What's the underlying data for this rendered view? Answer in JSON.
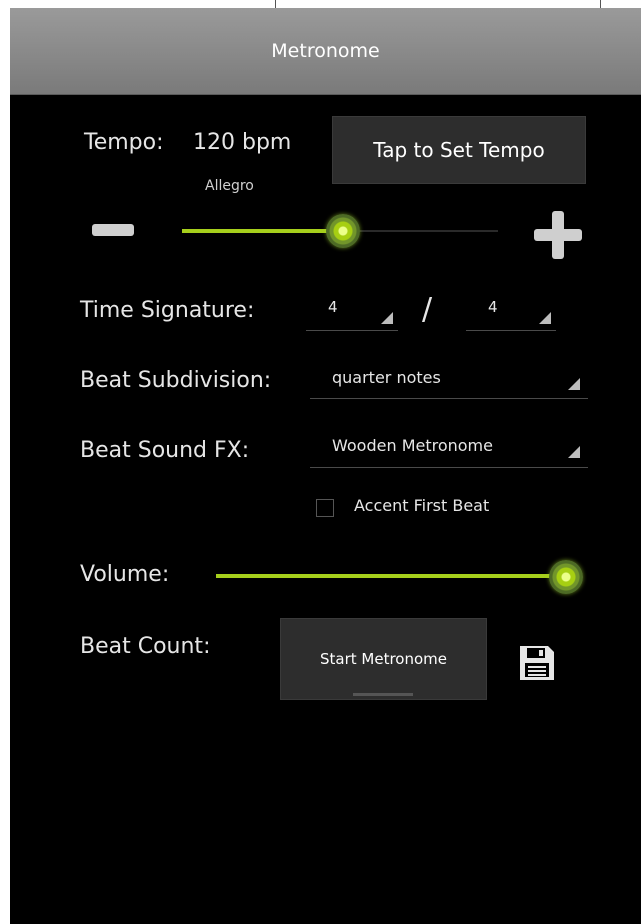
{
  "header": {
    "title": "Metronome"
  },
  "tempo": {
    "label": "Tempo:",
    "value": "120 bpm",
    "name": "Allegro",
    "tap_button": "Tap to Set Tempo",
    "slider_fraction": 0.5
  },
  "time_signature": {
    "label": "Time Signature:",
    "numerator": "4",
    "separator": "/",
    "denominator": "4"
  },
  "beat_subdivision": {
    "label": "Beat Subdivision:",
    "value": "quarter notes"
  },
  "beat_sound": {
    "label": "Beat Sound FX:",
    "value": "Wooden Metronome"
  },
  "accent": {
    "label": "Accent First Beat",
    "checked": false
  },
  "volume": {
    "label": "Volume:",
    "level_fraction": 1.0
  },
  "beat_count": {
    "label": "Beat Count:",
    "start_button": "Start Metronome"
  },
  "icons": {
    "decrease": "minus-icon",
    "increase": "plus-icon",
    "save": "save-icon",
    "dropdown": "dropdown-arrow-icon"
  },
  "colors": {
    "accent": "#a6cf1c",
    "background": "#000000",
    "titlebar": "#8a8a8a"
  }
}
